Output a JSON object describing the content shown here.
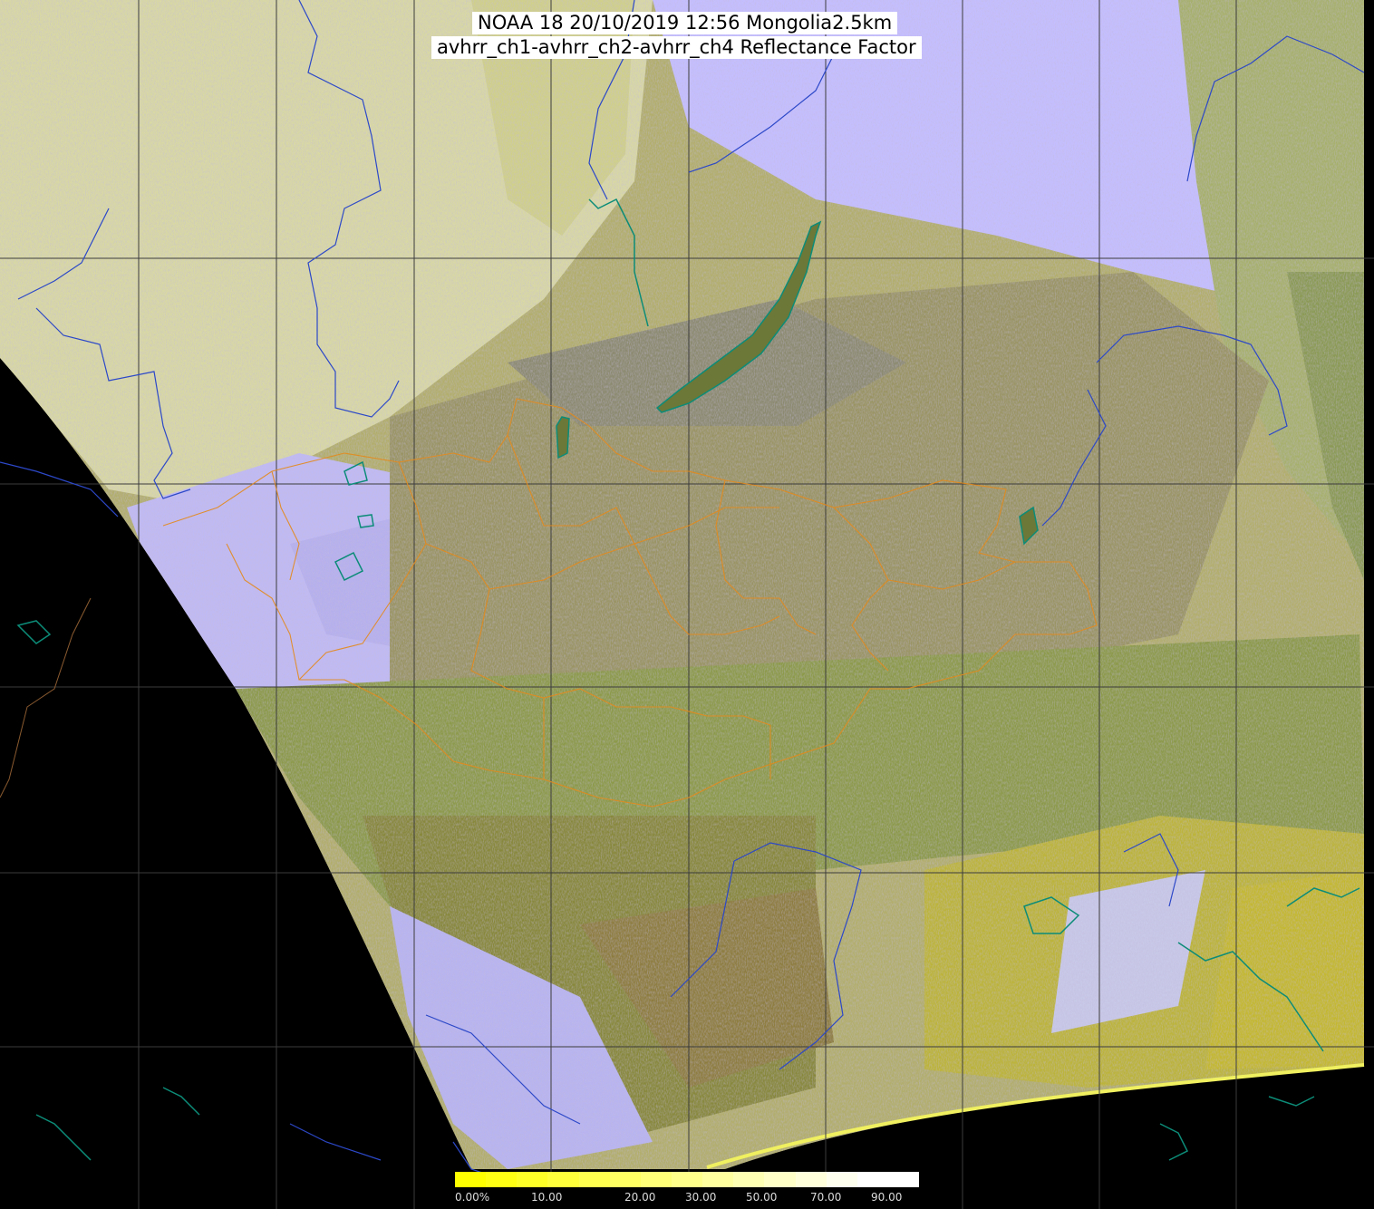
{
  "header": {
    "line1": "NOAA 18 20/10/2019 12:56 Mongolia2.5km",
    "line2": "avhrr_ch1-avhrr_ch2-avhrr_ch4 Reflectance Factor"
  },
  "legend": {
    "ticks": [
      "0.00%",
      "10.00",
      "20.00",
      "30.00",
      "50.00",
      "70.00",
      "90.00"
    ],
    "colors": [
      "#ffff00",
      "#ffff14",
      "#ffff28",
      "#ffff3c",
      "#ffff50",
      "#ffff64",
      "#ffff78",
      "#ffff8c",
      "#ffffa0",
      "#ffffb4",
      "#ffffc8",
      "#ffffdc",
      "#fffff0",
      "#ffffff",
      "#ffffff"
    ]
  },
  "palette": {
    "background": "#000000",
    "cloud": "#c8c0ff",
    "land": "#8a9a48",
    "snow_haze": "#d4d49a",
    "borders": "#ff8800",
    "rivers": "#2040c0",
    "coast": "#00a090",
    "grid": "#404040"
  }
}
